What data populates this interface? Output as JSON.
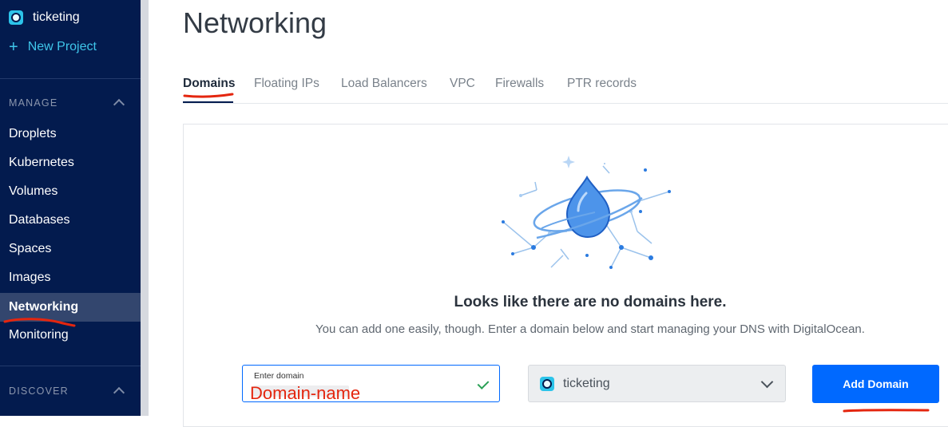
{
  "sidebar": {
    "project_name": "ticketing",
    "new_project_label": "New Project",
    "manage_section": "MANAGE",
    "items": [
      {
        "label": "Droplets"
      },
      {
        "label": "Kubernetes"
      },
      {
        "label": "Volumes"
      },
      {
        "label": "Databases"
      },
      {
        "label": "Spaces"
      },
      {
        "label": "Images"
      },
      {
        "label": "Networking",
        "active": true
      },
      {
        "label": "Monitoring"
      }
    ],
    "discover_section": "DISCOVER"
  },
  "main": {
    "title": "Networking",
    "tabs": [
      {
        "label": "Domains",
        "active": true
      },
      {
        "label": "Floating IPs"
      },
      {
        "label": "Load Balancers"
      },
      {
        "label": "VPC"
      },
      {
        "label": "Firewalls"
      },
      {
        "label": "PTR records"
      }
    ],
    "empty_state": {
      "title": "Looks like there are no domains here.",
      "subtitle": "You can add one easily, though. Enter a domain below and start managing your DNS with DigitalOcean."
    },
    "form": {
      "domain_label": "Enter domain",
      "domain_value": "",
      "project_selected": "ticketing",
      "submit_label": "Add Domain"
    }
  },
  "annotation": {
    "text": "Domain-name",
    "color": "#e4260f"
  },
  "colors": {
    "sidebar_bg": "#031b4e",
    "accent": "#0069ff",
    "link": "#3fc6ea"
  }
}
